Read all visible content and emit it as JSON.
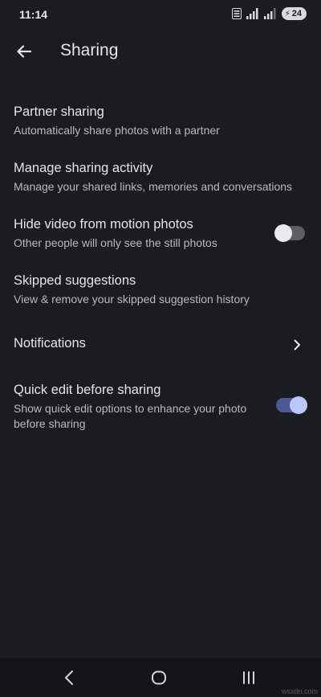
{
  "status_bar": {
    "time": "11:14",
    "battery_level": "24"
  },
  "app_bar": {
    "title": "Sharing"
  },
  "settings": [
    {
      "title": "Partner sharing",
      "subtitle": "Automatically share photos with a partner"
    },
    {
      "title": "Manage sharing activity",
      "subtitle": "Manage your shared links, memories and conversations"
    },
    {
      "title": "Hide video from motion photos",
      "subtitle": "Other people will only see the still photos",
      "toggle_on": false
    },
    {
      "title": "Skipped suggestions",
      "subtitle": "View & remove your skipped suggestion history"
    },
    {
      "title": "Notifications"
    },
    {
      "title": "Quick edit before sharing",
      "subtitle": "Show quick edit options to enhance your photo before sharing",
      "toggle_on": true
    }
  ],
  "watermark": "wsxdn.com",
  "colors": {
    "background": "#1b1c21",
    "toggle_on_track": "#4b5a95",
    "toggle_on_knob": "#b9c8ff",
    "toggle_off_track": "#5d5e65"
  }
}
